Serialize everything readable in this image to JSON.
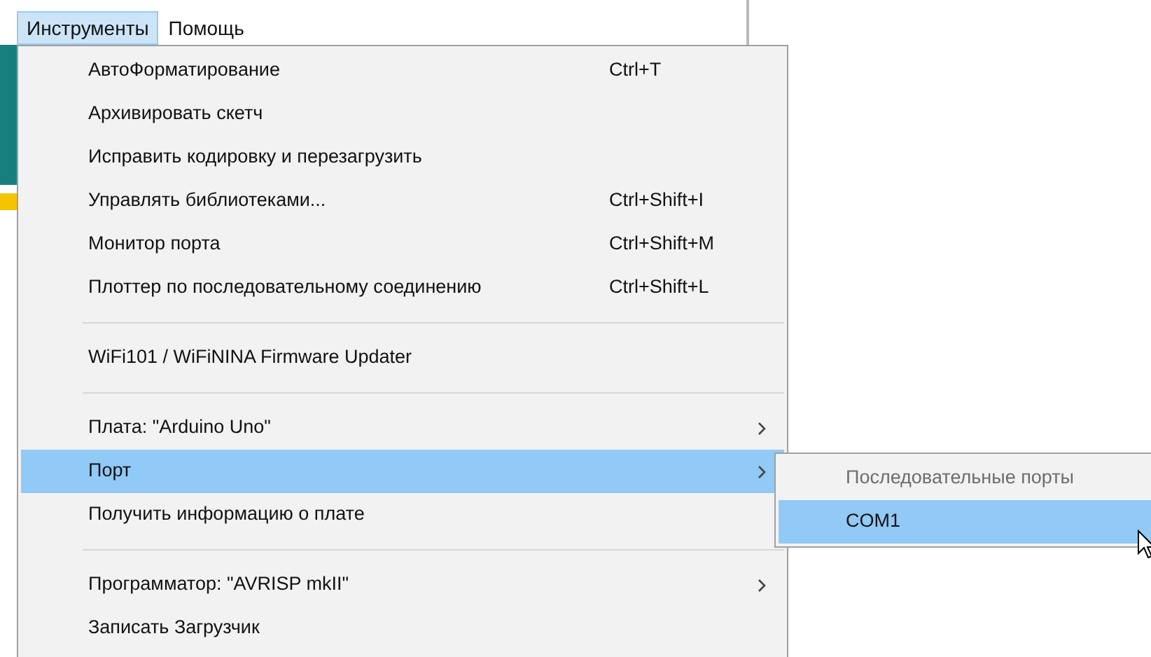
{
  "menubar": [
    {
      "label": "Инструменты",
      "selected": true
    },
    {
      "label": "Помощь",
      "selected": false
    }
  ],
  "menu": [
    {
      "kind": "item",
      "label": "АвтоФорматирование",
      "shortcut": "Ctrl+T",
      "submenu": false,
      "selected": false
    },
    {
      "kind": "item",
      "label": "Архивировать скетч",
      "submenu": false,
      "selected": false
    },
    {
      "kind": "item",
      "label": "Исправить кодировку и перезагрузить",
      "submenu": false,
      "selected": false
    },
    {
      "kind": "item",
      "label": "Управлять библиотеками...",
      "shortcut": "Ctrl+Shift+I",
      "submenu": false,
      "selected": false
    },
    {
      "kind": "item",
      "label": "Монитор порта",
      "shortcut": "Ctrl+Shift+M",
      "submenu": false,
      "selected": false
    },
    {
      "kind": "item",
      "label": "Плоттер по последовательному соединению",
      "shortcut": "Ctrl+Shift+L",
      "submenu": false,
      "selected": false
    },
    {
      "kind": "separator"
    },
    {
      "kind": "item",
      "label": "WiFi101 / WiFiNINA Firmware Updater",
      "submenu": false,
      "selected": false
    },
    {
      "kind": "separator"
    },
    {
      "kind": "item",
      "label": "Плата: \"Arduino Uno\"",
      "submenu": true,
      "selected": false
    },
    {
      "kind": "item",
      "label": "Порт",
      "submenu": true,
      "selected": true
    },
    {
      "kind": "item",
      "label": "Получить информацию о плате",
      "submenu": false,
      "selected": false
    },
    {
      "kind": "separator"
    },
    {
      "kind": "item",
      "label": "Программатор: \"AVRISP mkII\"",
      "submenu": true,
      "selected": false
    },
    {
      "kind": "item",
      "label": "Записать Загрузчик",
      "submenu": false,
      "selected": false
    }
  ],
  "submenu": [
    {
      "label": "Последовательные порты",
      "disabled": true,
      "selected": false
    },
    {
      "label": "COM1",
      "disabled": false,
      "selected": true
    }
  ]
}
